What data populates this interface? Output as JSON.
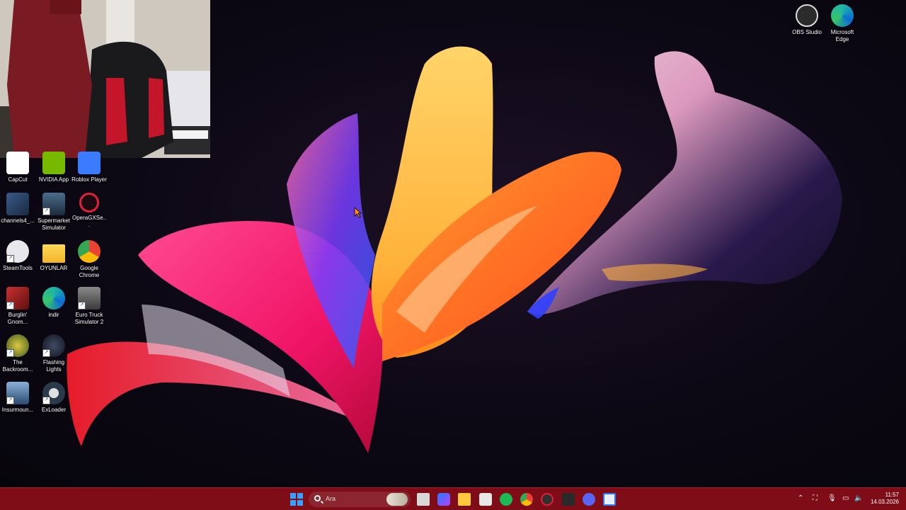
{
  "desktop_icons": {
    "obs": "OBS Studio",
    "edge_top": "Microsoft Edge",
    "capcut": "CapCut",
    "nvidia": "NVIDIA App",
    "roblox": "Roblox Player",
    "channels": "channels4_...",
    "supermarket": "Supermarket Simulator",
    "opera": "OperaGXSe...",
    "steamtools": "SteamTools",
    "oyunlar": "OYUNLAR",
    "chrome": "Google Chrome",
    "burglin": "Burglin' Gnom...",
    "indir": "indir",
    "ets2": "Euro Truck Simulator 2",
    "backrooms": "The Backroom...",
    "flashing": "Flashing Lights",
    "insurmountable": "Insurmoun...",
    "exloader": "ExLoader"
  },
  "taskbar": {
    "search_placeholder": "Ara",
    "time": "11:57",
    "date": "14.03.2026"
  },
  "colors": {
    "taskbar": "#7e0d17",
    "accent_start": "#0a84ff"
  }
}
